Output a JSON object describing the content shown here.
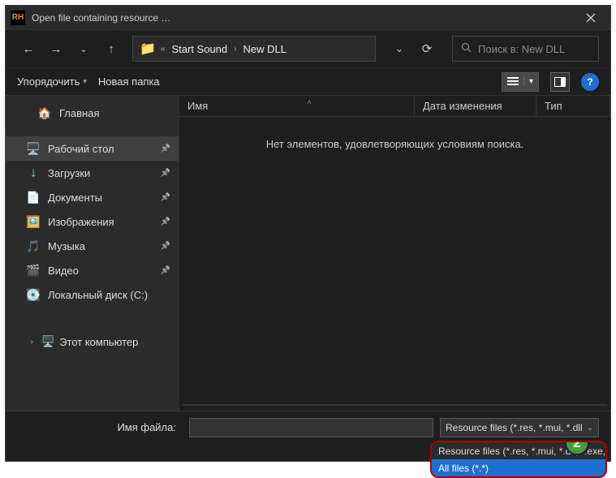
{
  "window": {
    "title": "Open file containing resource …",
    "app_icon_text": "RH"
  },
  "nav": {
    "breadcrumb": [
      "Start Sound",
      "New DLL"
    ],
    "search_placeholder": "Поиск в: New DLL"
  },
  "toolbar": {
    "organize": "Упорядочить",
    "new_folder": "Новая папка"
  },
  "sidebar": {
    "home": "Главная",
    "items": [
      {
        "icon": "🖥️",
        "label": "Рабочий стол",
        "selected": true
      },
      {
        "icon": "⬇",
        "label": "Загрузки",
        "accent": "#5ec85e"
      },
      {
        "icon": "📄",
        "label": "Документы",
        "accent": "#4aa0e8"
      },
      {
        "icon": "🖼️",
        "label": "Изображения",
        "accent": "#2e90d0"
      },
      {
        "icon": "🎵",
        "label": "Музыка",
        "accent": "#d14a8a"
      },
      {
        "icon": "🎬",
        "label": "Видео",
        "accent": "#7a4ad0"
      },
      {
        "icon": "💽",
        "label": "Локальный диск (C:)"
      }
    ],
    "computer": "Этот компьютер"
  },
  "columns": {
    "name": "Имя",
    "date": "Дата изменения",
    "type": "Тип"
  },
  "main": {
    "empty": "Нет элементов, удовлетворяющих условиям поиска."
  },
  "footer": {
    "filename_label": "Имя файла:",
    "filetype_selected": "Resource files (*.res, *.mui, *.dll",
    "options": [
      "Resource files (*.res, *.mui, *.dll, *.exe,",
      "All files (*.*)"
    ],
    "badge": "2"
  }
}
